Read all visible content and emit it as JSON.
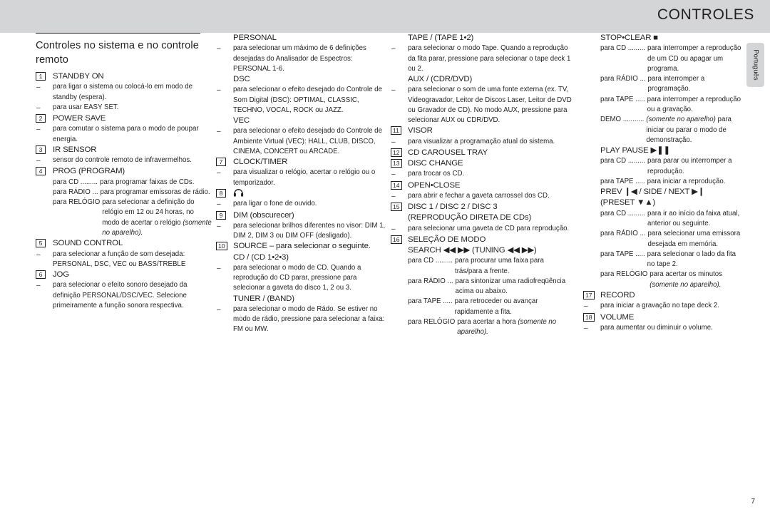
{
  "header": {
    "title": "CONTROLES",
    "language_tab": "Português"
  },
  "page_number": "7",
  "section": {
    "title": "Controles no sistema e no controle remoto"
  },
  "columns": [
    {
      "id": "column-1",
      "items": [
        {
          "num": "1",
          "heading": "STANDBY ON",
          "lines": [
            {
              "marker": "dash",
              "text": "para ligar o sistema ou colocá-lo em modo de standby (espera)."
            },
            {
              "marker": "dash",
              "text": "para usar EASY SET."
            }
          ]
        },
        {
          "num": "2",
          "heading": "POWER SAVE",
          "lines": [
            {
              "marker": "dash",
              "text": "para comutar o sistema para o modo de poupar energia."
            }
          ]
        },
        {
          "num": "3",
          "heading": "IR SENSOR",
          "lines": [
            {
              "marker": "dash",
              "text": "sensor do controle remoto de infravermelhos."
            }
          ]
        },
        {
          "num": "4",
          "heading": "PROG (PROGRAM)",
          "defs": [
            {
              "term": "para CD .........",
              "desc": "para programar faixas de CDs."
            },
            {
              "term": "para RÁDIO ...",
              "desc": "para programar emissoras de rádio."
            },
            {
              "term": "para RELÓGIO",
              "desc": "para selecionar a definição do relógio em 12 ou 24 horas, no modo de acertar o relógio ",
              "desc_italic": "(somente no aparelho)."
            }
          ]
        },
        {
          "num": "5",
          "heading": "SOUND CONTROL",
          "lines": [
            {
              "marker": "dash",
              "text": "para selecionar a função de som desejada: PERSONAL, DSC, VEC ou BASS/TREBLE"
            }
          ]
        },
        {
          "num": "6",
          "heading": "JOG",
          "lines": [
            {
              "marker": "dash",
              "text": "para selecionar o efeito sonoro desejado da definição PERSONAL/DSC/VEC. Selecione primeiramente a função sonora respectiva."
            }
          ]
        }
      ]
    },
    {
      "id": "column-2",
      "items": [
        {
          "num": "",
          "heading": "PERSONAL",
          "lines": [
            {
              "marker": "dash",
              "text": "para selecionar um máximo de 6 definições desejadas do Analisador de Espectros: PERSONAL 1-6."
            }
          ]
        },
        {
          "num": "",
          "heading": "DSC",
          "lines": [
            {
              "marker": "dash",
              "text": "para selecionar o efeito desejado do Controle de Som Digital (DSC): OPTIMAL, CLASSIC, TECHNO, VOCAL, ROCK ou JAZZ."
            }
          ]
        },
        {
          "num": "",
          "heading": "VEC",
          "lines": [
            {
              "marker": "dash",
              "text": "para selecionar o efeito desejado do Controle de Ambiente Virtual (VEC): HALL, CLUB, DISCO, CINEMA, CONCERT ou ARCADE."
            }
          ]
        },
        {
          "num": "7",
          "heading": "CLOCK/TIMER",
          "lines": [
            {
              "marker": "dash",
              "text": "para visualizar o relógio, acertar o relógio ou o temporizador."
            }
          ]
        },
        {
          "num": "8",
          "heading": "headphone-icon",
          "heading_is_icon": true,
          "lines": [
            {
              "marker": "dash",
              "text": "para ligar o fone de ouvido."
            }
          ]
        },
        {
          "num": "9",
          "heading": "DIM (obscurecer)",
          "lines": [
            {
              "marker": "dash",
              "text": "para selecionar brilhos diferentes no visor: DIM 1, DIM 2, DIM 3 ou DIM OFF (desligado)."
            }
          ]
        },
        {
          "num": "10",
          "heading": "SOURCE – para selecionar o seguinte.",
          "subsections": [
            {
              "heading": "CD / (CD 1•2•3)",
              "lines": [
                {
                  "marker": "dash",
                  "text": "para selecionar o modo de CD. Quando a reprodução do CD parar, pressione para selecionar a gaveta do disco 1, 2 ou 3."
                }
              ]
            },
            {
              "heading": "TUNER / (BAND)",
              "lines": [
                {
                  "marker": "dash",
                  "text": "para selecionar o modo de Rádo. Se estiver no modo de rádio, pressione para selecionar a faixa: FM ou MW."
                }
              ]
            }
          ]
        }
      ]
    },
    {
      "id": "column-3",
      "items": [
        {
          "num": "",
          "heading": "TAPE / (TAPE 1•2)",
          "lines": [
            {
              "marker": "dash",
              "text": "para selecionar o modo Tape. Quando a reprodução da fita parar, pressione para selecionar o tape deck 1 ou 2."
            }
          ]
        },
        {
          "num": "",
          "heading": "AUX / (CDR/DVD)",
          "lines": [
            {
              "marker": "dash",
              "text": "para selecionar o som de uma fonte externa (ex. TV, Videogravador, Leitor de Discos Laser, Leitor de DVD ou Gravador de CD). No modo AUX, pressione para selecionar AUX ou CDR/DVD."
            }
          ]
        },
        {
          "num": "11",
          "heading": "VISOR",
          "lines": [
            {
              "marker": "dash",
              "text": "para visualizar a programação atual do sistema."
            }
          ]
        },
        {
          "num": "12",
          "heading": "CD CAROUSEL TRAY",
          "lines": []
        },
        {
          "num": "13",
          "heading": "DISC CHANGE",
          "lines": [
            {
              "marker": "dash",
              "text": "para trocar os CD."
            }
          ]
        },
        {
          "num": "14",
          "heading": "OPEN•CLOSE",
          "lines": [
            {
              "marker": "dash",
              "text": "para abrir e fechar a gaveta carrossel dos CD."
            }
          ]
        },
        {
          "num": "15",
          "heading": "DISC 1 / DISC 2 / DISC 3",
          "heading2": "(REPRODUÇÃO DIRETA DE CDs)",
          "lines": [
            {
              "marker": "dash",
              "text": "para selecionar uma gaveta de CD para reprodução."
            }
          ]
        },
        {
          "num": "16",
          "heading": "SELEÇÃO DE MODO",
          "heading2": "SEARCH ◀◀ ▶▶  (TUNING ◀◀ ▶▶)",
          "defs": [
            {
              "term": "para CD .........",
              "desc": "para procurar uma faixa para trás/para a frente."
            },
            {
              "term": "para RÁDIO ...",
              "desc": "para sintonizar uma radiofreqüência acima ou abaixo."
            },
            {
              "term": "para TAPE .....",
              "desc": "para retroceder ou avançar rapidamente a fita."
            },
            {
              "term": "para RELÓGIO",
              "desc": "para acertar a hora ",
              "desc_italic": "(somente no aparelho)."
            }
          ]
        }
      ]
    },
    {
      "id": "column-4",
      "items": [
        {
          "num": "",
          "heading": "STOP•CLEAR ■",
          "defs": [
            {
              "term": "para CD .........",
              "desc": "para interromper a reprodução de um CD ou apagar um programa."
            },
            {
              "term": "para RÁDIO ...",
              "desc": "para interromper a programação."
            },
            {
              "term": "para TAPE .....",
              "desc": "para interromper a reprodução ou a gravação."
            },
            {
              "term": "DEMO ...........",
              "desc": "",
              "desc_italic_first": "(somente no aparelho)",
              "desc_after": " para iniciar ou parar o modo de demonstração."
            }
          ]
        },
        {
          "num": "",
          "heading": "PLAY  PAUSE ▶❚❚",
          "defs": [
            {
              "term": "para CD .........",
              "desc": "para parar ou interromper a reprodução."
            },
            {
              "term": "para TAPE .....",
              "desc": "para iniciar a reprodução."
            }
          ]
        },
        {
          "num": "",
          "heading": "PREV ❙◀  / SIDE / NEXT ▶❙",
          "heading2": "(PRESET ▼▲)",
          "defs": [
            {
              "term": "para CD .........",
              "desc": "para ir ao início da faixa atual, anterior ou seguinte."
            },
            {
              "term": "para RÁDIO ...",
              "desc": "para selecionar uma emissora desejada em memória."
            },
            {
              "term": "para TAPE .....",
              "desc": "para selecionar o lado da fita no tape 2."
            },
            {
              "term": "para RELÓGIO",
              "desc": "para acertar os minutos ",
              "desc_italic": "(somente no aparelho)."
            }
          ]
        },
        {
          "num": "17",
          "heading": "RECORD",
          "lines": [
            {
              "marker": "dash",
              "text": "para iniciar a gravação no tape deck 2."
            }
          ]
        },
        {
          "num": "18",
          "heading": "VOLUME",
          "lines": [
            {
              "marker": "dash",
              "text": "para aumentar ou diminuir o volume."
            }
          ]
        }
      ]
    }
  ]
}
